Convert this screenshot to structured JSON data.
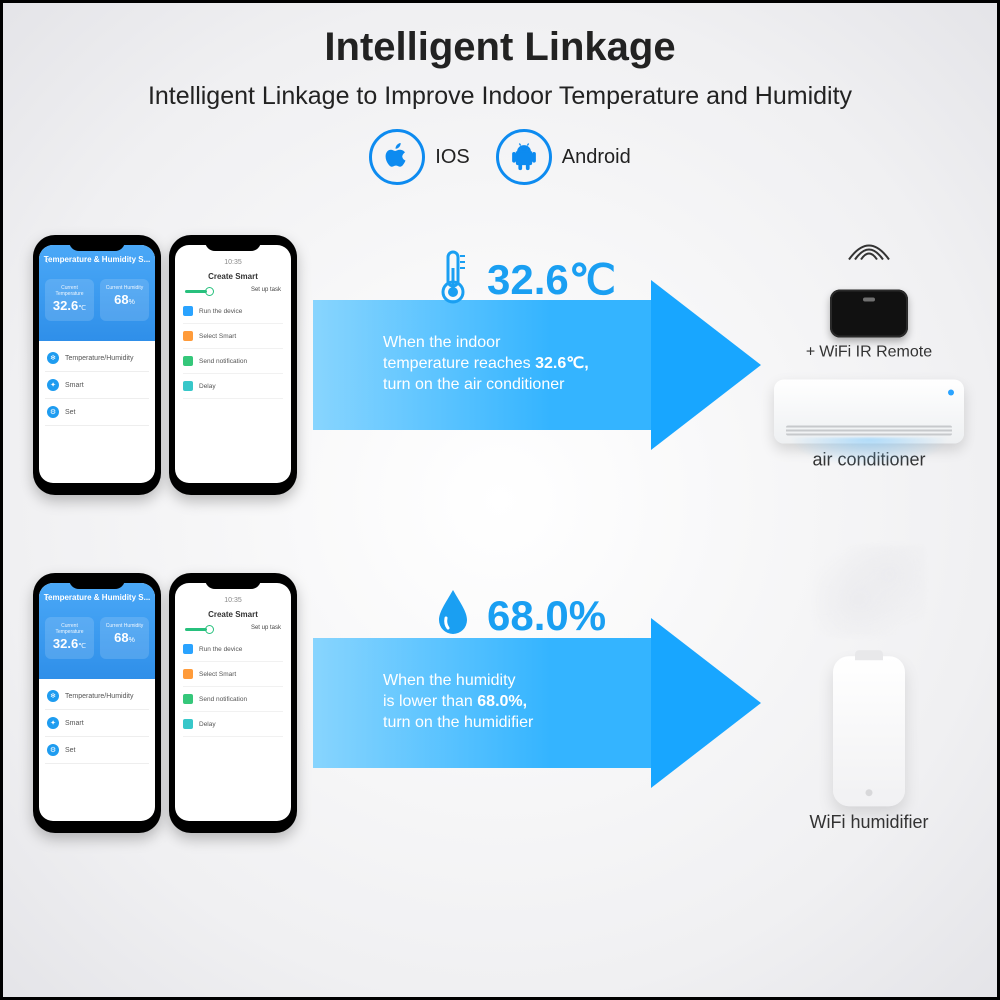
{
  "header": {
    "title": "Intelligent Linkage",
    "subtitle": "Intelligent Linkage to Improve Indoor Temperature and Humidity"
  },
  "os": {
    "ios_label": "IOS",
    "android_label": "Android"
  },
  "phone_blue": {
    "header": "Temperature & Humidity S...",
    "temp_label": "Current Temperature",
    "temp_value": "32.6",
    "temp_unit": "℃",
    "hum_label": "Current Humidity",
    "hum_value": "68",
    "hum_unit": "%",
    "list": {
      "item1": "Temperature/Humidity",
      "item2": "Smart",
      "item3": "Set"
    }
  },
  "phone_white": {
    "header": "Create Smart",
    "setup_label": "Set up task",
    "items": {
      "a": "Run the device",
      "b": "Select Smart",
      "c": "Send notification",
      "d": "Delay"
    }
  },
  "scenario_temp": {
    "value": "32.6℃",
    "line1": "When the indoor",
    "line2a": "temperature reaches ",
    "line2b": "32.6℃,",
    "line3": "turn on the air conditioner"
  },
  "scenario_hum": {
    "value": "68.0%",
    "line1": "When the  humidity",
    "line2a": "is lower than ",
    "line2b": "68.0%,",
    "line3": "turn on the humidifier"
  },
  "devices": {
    "ir_plus": "+",
    "ir_label": "WiFi IR Remote",
    "ac_label": "air conditioner",
    "humidifier_label": "WiFi humidifier"
  }
}
